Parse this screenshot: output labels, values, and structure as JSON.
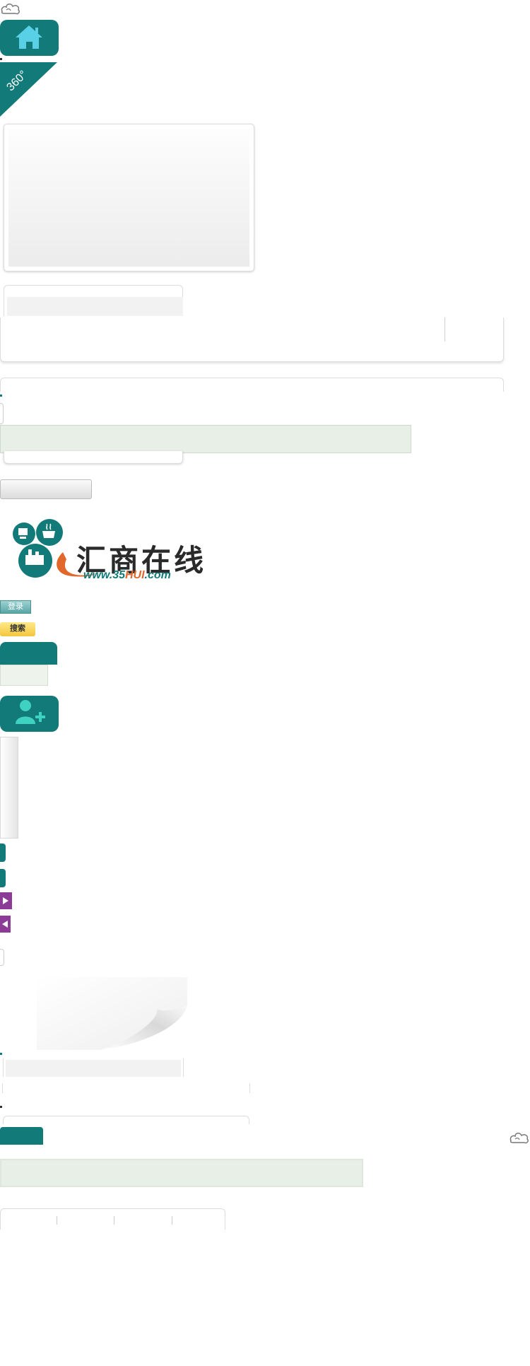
{
  "logo": {
    "title_cn": "汇商在线",
    "url_text": "www.35HUI.com",
    "url_prefix": "www.35",
    "url_accent": "HUI",
    "url_suffix": ".com",
    "accent_color": "#e2672b",
    "brand_color": "#137a7a"
  },
  "badge_360": "360°",
  "buttons": {
    "login": "登录",
    "search": "搜索"
  },
  "icons": {
    "cloud": "cloud-ornament-icon",
    "home": "home-icon",
    "add_user": "add-user-icon",
    "arrow_right": "arrow-right-icon",
    "arrow_left": "arrow-left-icon"
  },
  "colors": {
    "teal": "#137a7a",
    "purple": "#8c3b96",
    "panel_green": "#e8efe6"
  }
}
